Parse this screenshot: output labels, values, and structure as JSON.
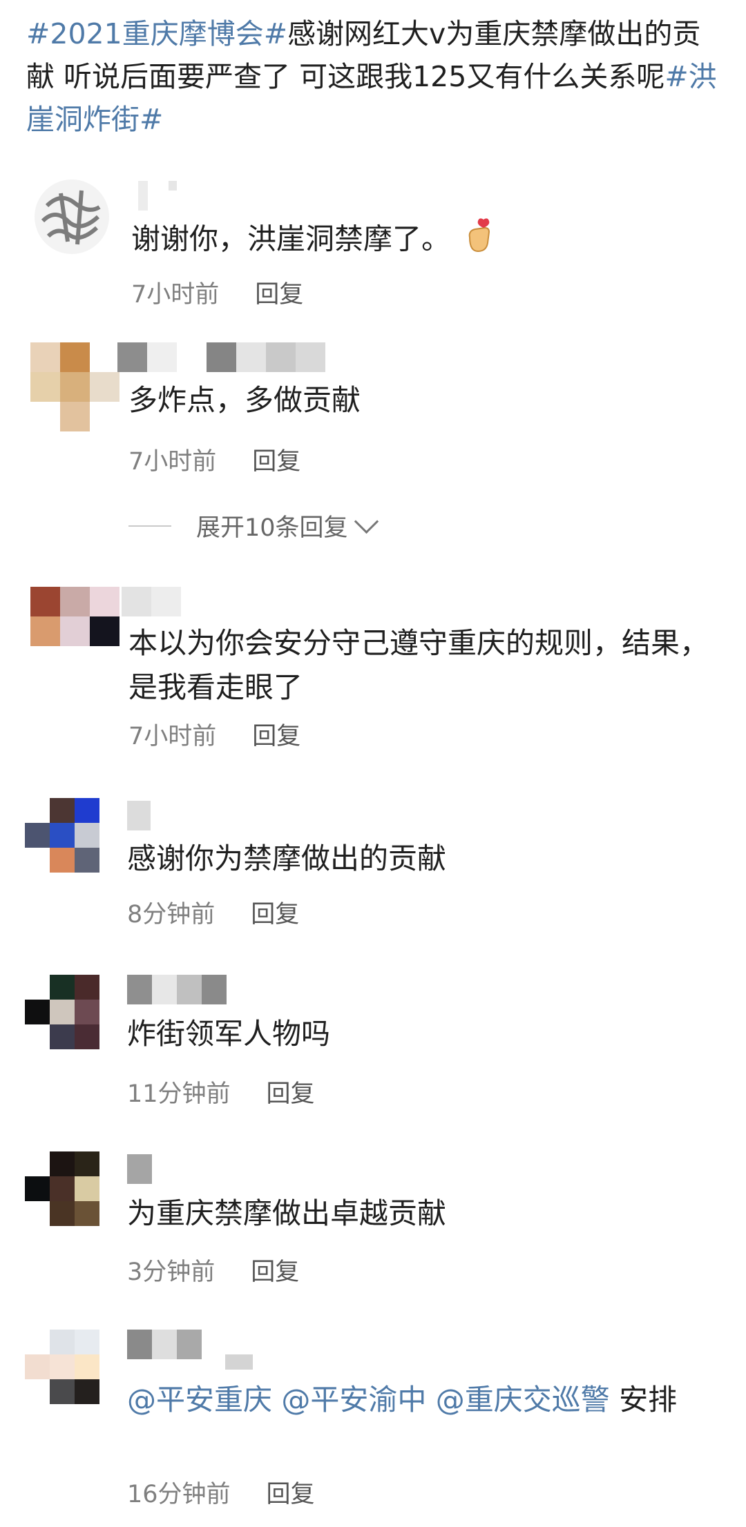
{
  "post": {
    "tag1": "#2021重庆摩博会#",
    "text": "感谢网红大v为重庆禁摩做出的贡献 听说后面要严查了 可这跟我125又有什么关系呢",
    "tag2": "#洪崖洞炸街#"
  },
  "comments": [
    {
      "text": "谢谢你，洪崖洞禁摩了。",
      "emoji": "finger-heart-icon",
      "time": "7小时前",
      "reply": "回复"
    },
    {
      "text": "多炸点，多做贡献",
      "time": "7小时前",
      "reply": "回复",
      "expand": "展开10条回复"
    },
    {
      "text": "本以为你会安分守己遵守重庆的规则，结果，是我看走眼了",
      "time": "7小时前",
      "reply": "回复"
    },
    {
      "text": "感谢你为禁摩做出的贡献",
      "time": "8分钟前",
      "reply": "回复"
    },
    {
      "text": "炸街领军人物吗",
      "time": "11分钟前",
      "reply": "回复"
    },
    {
      "text": "为重庆禁摩做出卓越贡献",
      "time": "3分钟前",
      "reply": "回复"
    },
    {
      "mentions": [
        "@平安重庆",
        "@平安渝中",
        "@重庆交巡警"
      ],
      "text": "安排",
      "time": "16分钟前",
      "reply": "回复"
    }
  ],
  "colors": {
    "link": "#4f7aa8",
    "meta": "#7f7f7f",
    "text": "#1f1f1f"
  }
}
